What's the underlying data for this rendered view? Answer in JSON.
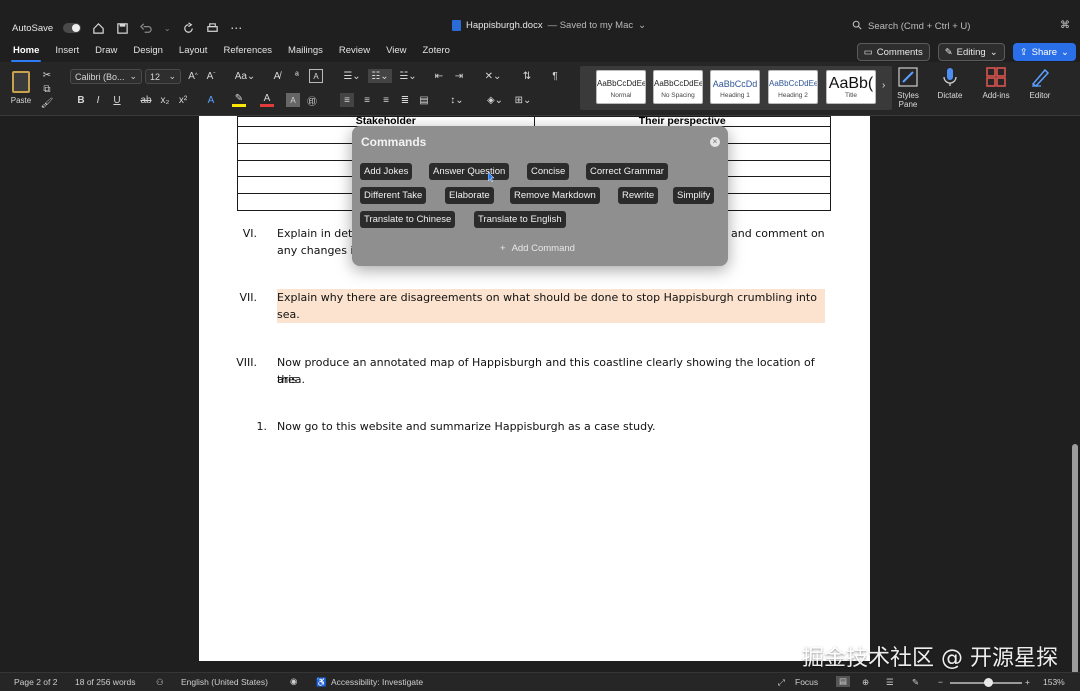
{
  "titlebar": {
    "autosave_label": "AutoSave",
    "doc_name": "Happisburgh.docx",
    "doc_status": "— Saved to my Mac",
    "search_placeholder": "Search (Cmd + Ctrl + U)"
  },
  "tabs": [
    "Home",
    "Insert",
    "Draw",
    "Design",
    "Layout",
    "References",
    "Mailings",
    "Review",
    "View",
    "Zotero"
  ],
  "tab_actions": {
    "comments": "Comments",
    "editing": "Editing",
    "share": "Share"
  },
  "ribbon": {
    "paste_label": "Paste",
    "font_name": "Calibri (Bo...",
    "font_size": "12",
    "styles": [
      {
        "sample": "AaBbCcDdEe",
        "name": "Normal"
      },
      {
        "sample": "AaBbCcDdEe",
        "name": "No Spacing"
      },
      {
        "sample": "AaBbCcDd",
        "name": "Heading 1"
      },
      {
        "sample": "AaBbCcDdEe",
        "name": "Heading 2"
      },
      {
        "sample": "AaBb(",
        "name": "Title"
      }
    ],
    "styles_pane": "Styles Pane",
    "dictate": "Dictate",
    "addins": "Add-ins",
    "editor": "Editor"
  },
  "document": {
    "table_headers": [
      "Stakeholder",
      "Their perspective"
    ],
    "items": [
      {
        "num": "VI.",
        "line1_start": "Explain in deta",
        "line1_end": "and comment on",
        "line2": "any changes in"
      },
      {
        "num": "VII.",
        "line1": "Explain why there are disagreements on what should be done to stop Happisburgh crumbling into the",
        "line2": "sea."
      },
      {
        "num": "VIII.",
        "line1": "Now produce an annotated map of Happisburgh and this coastline clearly showing the location of this",
        "line2": "area."
      },
      {
        "num": "1.",
        "line1": "Now go to this website and summarize Happisburgh as a case study."
      }
    ]
  },
  "commands_popup": {
    "title": "Commands",
    "commands": [
      "Add Jokes",
      "Answer Question",
      "Concise",
      "Correct Grammar",
      "Different Take",
      "Elaborate",
      "Remove Markdown",
      "Rewrite",
      "Simplify",
      "Translate to Chinese",
      "Translate to English"
    ],
    "add_command": "Add Command"
  },
  "statusbar": {
    "page": "Page 2 of 2",
    "words": "18 of 256 words",
    "language": "English (United States)",
    "accessibility": "Accessibility: Investigate",
    "focus": "Focus",
    "zoom": "153%",
    "zoom_level_percent": 153
  },
  "watermark": "掘金技术社区 @ 开源星探"
}
